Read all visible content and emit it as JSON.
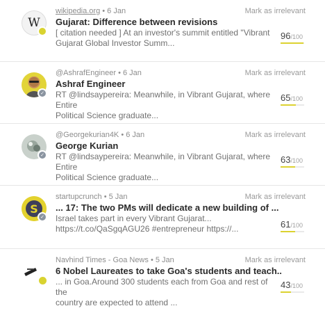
{
  "irrelevant_label": "Mark as irrelevant",
  "score_denominator": "/100",
  "accent_color": "#dcd230",
  "items": [
    {
      "avatar_icon": "wikipedia-logo",
      "badge_icon": "site-badge",
      "source": "wikipedia.org",
      "date": "• 6 Jan",
      "title": "Gujarat: Difference between revisions",
      "snippet_1": "[ citation needed ] At an investor's summit entitled \"Vibrant",
      "snippet_2": "Gujarat Global Investor Summ...",
      "score": "96",
      "score_fraction": 0.96
    },
    {
      "avatar_icon": "user-avatar",
      "badge_icon": "twitter-badge",
      "source": "@AshrafEngineer",
      "date": "• 6 Jan",
      "title": "Ashraf Engineer",
      "snippet_1": "RT @lindsaypereira: Meanwhile, in Vibrant Gujarat, where Entire",
      "snippet_2": "Political Science graduate...",
      "score": "65",
      "score_fraction": 0.65
    },
    {
      "avatar_icon": "user-avatar",
      "badge_icon": "twitter-badge",
      "source": "@Georgekurian4K",
      "date": "• 6 Jan",
      "title": "George Kurian",
      "snippet_1": "RT @lindsaypereira: Meanwhile, in Vibrant Gujarat, where Entire",
      "snippet_2": "Political Science graduate...",
      "score": "63",
      "score_fraction": 0.63
    },
    {
      "avatar_icon": "startupcrunch-logo",
      "badge_icon": "twitter-badge",
      "source": "startupcrunch",
      "date": "• 5 Jan",
      "title": "... 17: The two PMs will dedicate a new building of ...",
      "snippet_1": "Israel takes part in every Vibrant Gujarat...",
      "snippet_2": "https://t.co/QaSgqAGU26 #entrepreneur https://...",
      "score": "61",
      "score_fraction": 0.61
    },
    {
      "avatar_icon": "news-logo",
      "badge_icon": "site-badge",
      "source": "Navhind Times - Goa News",
      "date": "• 5 Jan",
      "title": "6 Nobel Laureates to take Goa's students and teach...",
      "snippet_1": "... in Goa.Around 300 students each from Goa and rest of the",
      "snippet_2": "country are expected to attend ...",
      "score": "43",
      "score_fraction": 0.43
    }
  ]
}
